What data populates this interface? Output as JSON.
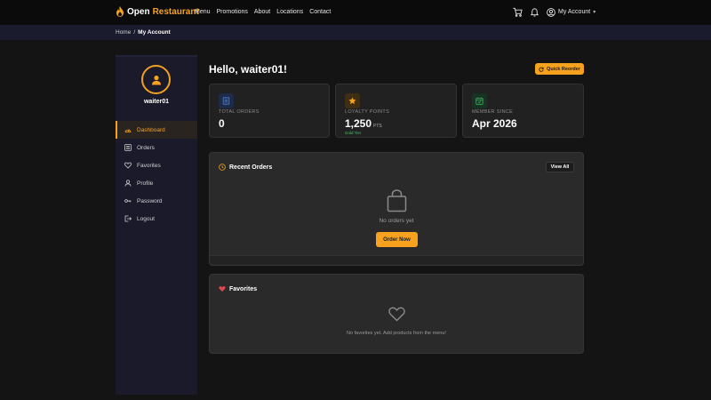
{
  "nav": {
    "brand_first": "Open",
    "brand_second": "Restaurant",
    "links": [
      "Menu",
      "Promotions",
      "About",
      "Locations",
      "Contact"
    ],
    "account_label": "My Account"
  },
  "breadcrumb": {
    "home": "Home",
    "separator": "/",
    "current": "My Account"
  },
  "sidebar": {
    "username": "waiter01",
    "items": [
      {
        "label": "Dashboard",
        "icon": "speedometer-icon",
        "active": true
      },
      {
        "label": "Orders",
        "icon": "list-icon",
        "active": false
      },
      {
        "label": "Favorites",
        "icon": "heart-icon",
        "active": false
      },
      {
        "label": "Profile",
        "icon": "user-icon",
        "active": false
      },
      {
        "label": "Password",
        "icon": "key-icon",
        "active": false
      },
      {
        "label": "Logout",
        "icon": "logout-icon",
        "active": false
      }
    ]
  },
  "main": {
    "greeting": "Hello, waiter01!",
    "quick_reorder": "Quick Reorder",
    "stats": [
      {
        "label": "TOTAL ORDERS",
        "value": "0",
        "icon": "receipt-icon",
        "color": "#3b6fd6"
      },
      {
        "label": "LOYALTY POINTS",
        "value": "1,250",
        "unit": "PTS",
        "tier": "Gold Tier",
        "icon": "star-icon",
        "color": "#f6a21e"
      },
      {
        "label": "MEMBER SINCE",
        "value": "Apr 2026",
        "icon": "calendar-icon",
        "color": "#3fb25a"
      }
    ],
    "recent_orders": {
      "title": "Recent Orders",
      "view_all": "View All",
      "empty": "No orders yet",
      "cta": "Order Now"
    },
    "favorites": {
      "title": "Favorites",
      "empty": "No favorites yet. Add products from the menu!"
    }
  },
  "colors": {
    "accent": "#f6a21e",
    "page_bg": "#141414",
    "sidebar_bg": "#1a1a2b",
    "panel_bg": "#2a2a2a"
  }
}
